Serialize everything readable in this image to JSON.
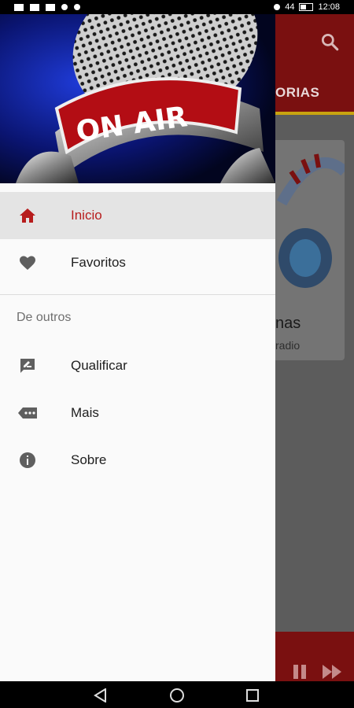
{
  "status_bar": {
    "battery": "44",
    "time": "12:08"
  },
  "background": {
    "tab_partial": "ORIAS",
    "card_title_partial": "nas",
    "card_sub_partial": "radio"
  },
  "drawer": {
    "header_text": "ON AIR",
    "items": [
      {
        "label": "Inicio",
        "icon": "home-icon",
        "active": true
      },
      {
        "label": "Favoritos",
        "icon": "heart-icon"
      }
    ],
    "section_label": "De outros",
    "other_items": [
      {
        "label": "Qualificar",
        "icon": "rate-review-icon"
      },
      {
        "label": "Mais",
        "icon": "more-icon"
      },
      {
        "label": "Sobre",
        "icon": "info-icon"
      }
    ]
  },
  "colors": {
    "accent": "#b71c1c",
    "toolbar": "#7a1010",
    "tab_indicator": "#c9a410"
  }
}
